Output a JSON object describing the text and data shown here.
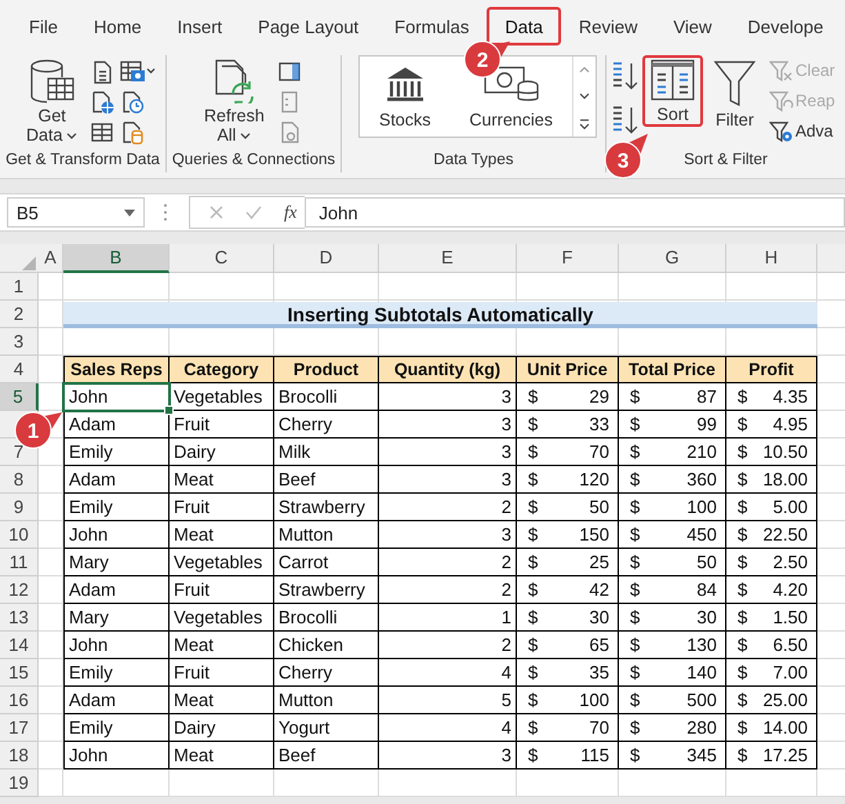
{
  "tabs": [
    {
      "label": "File",
      "selected": false,
      "highlighted": false
    },
    {
      "label": "Home",
      "selected": false,
      "highlighted": false
    },
    {
      "label": "Insert",
      "selected": false,
      "highlighted": false
    },
    {
      "label": "Page Layout",
      "selected": false,
      "highlighted": false
    },
    {
      "label": "Formulas",
      "selected": false,
      "highlighted": false
    },
    {
      "label": "Data",
      "selected": true,
      "highlighted": true
    },
    {
      "label": "Review",
      "selected": false,
      "highlighted": false
    },
    {
      "label": "View",
      "selected": false,
      "highlighted": false
    },
    {
      "label": "Develope",
      "selected": false,
      "highlighted": false
    }
  ],
  "ribbon": {
    "groups": [
      {
        "kind": "get",
        "label": "Get & Transform Data",
        "button": {
          "kind": "get-data",
          "label": "Get",
          "label2": "Data",
          "dropdown": true
        },
        "small_icons": [
          {
            "kind": "text-file",
            "disabled": false
          },
          {
            "kind": "web",
            "disabled": false
          },
          {
            "kind": "table",
            "disabled": false
          },
          {
            "kind": "camera",
            "disabled": false
          },
          {
            "kind": "recent",
            "disabled": false
          },
          {
            "kind": "existing",
            "disabled": false
          }
        ]
      },
      {
        "kind": "queries",
        "label": "Queries & Connections",
        "button": {
          "kind": "refresh",
          "label": "Refresh",
          "label2": "All",
          "dropdown": true
        },
        "small_icons": [
          {
            "kind": "panel",
            "disabled": false
          },
          {
            "kind": "properties",
            "disabled": true
          },
          {
            "kind": "links",
            "disabled": true
          }
        ]
      },
      {
        "kind": "types",
        "label": "Data Types",
        "gallery": [
          {
            "kind": "stocks",
            "label": "Stocks"
          },
          {
            "kind": "currencies",
            "label": "Currencies"
          }
        ]
      },
      {
        "kind": "sort",
        "label": "Sort & Filter",
        "sort_buttons": [
          {
            "kind": "az"
          },
          {
            "kind": "za"
          }
        ],
        "buttons": [
          {
            "kind": "sort",
            "label": "Sort",
            "highlighted": true
          },
          {
            "kind": "filter",
            "label": "Filter",
            "highlighted": false
          }
        ],
        "options": [
          {
            "kind": "clear",
            "label": "Clear",
            "disabled": true
          },
          {
            "kind": "reapply",
            "label": "Reap",
            "disabled": true
          },
          {
            "kind": "advanced",
            "label": "Adva",
            "disabled": false
          }
        ]
      }
    ]
  },
  "formula_bar": {
    "name_box": "B5",
    "function_label": "fx",
    "value": "John"
  },
  "sheet": {
    "columns": [
      {
        "label": "A",
        "selected": false
      },
      {
        "label": "B",
        "selected": true
      },
      {
        "label": "C",
        "selected": false
      },
      {
        "label": "D",
        "selected": false
      },
      {
        "label": "E",
        "selected": false
      },
      {
        "label": "F",
        "selected": false
      },
      {
        "label": "G",
        "selected": false
      },
      {
        "label": "H",
        "selected": false
      }
    ],
    "rows": [
      {
        "label": "1",
        "selected": false
      },
      {
        "label": "2",
        "selected": false
      },
      {
        "label": "3",
        "selected": false
      },
      {
        "label": "4",
        "selected": false
      },
      {
        "label": "5",
        "selected": true
      },
      {
        "selected": false
      },
      {
        "label": "7",
        "selected": false
      },
      {
        "label": "8",
        "selected": false
      },
      {
        "label": "9",
        "selected": false
      },
      {
        "label": "10",
        "selected": false
      },
      {
        "label": "11",
        "selected": false
      },
      {
        "label": "12",
        "selected": false
      },
      {
        "label": "13",
        "selected": false
      },
      {
        "label": "14",
        "selected": false
      },
      {
        "label": "15",
        "selected": false
      },
      {
        "label": "16",
        "selected": false
      },
      {
        "label": "17",
        "selected": false
      },
      {
        "label": "18",
        "selected": false
      },
      {
        "label": "19",
        "selected": false
      }
    ],
    "title": "Inserting Subtotals Automatically",
    "table": {
      "columns": [
        {
          "label": "Sales Reps",
          "kind": "text"
        },
        {
          "label": "Category",
          "kind": "text"
        },
        {
          "label": "Product",
          "kind": "text"
        },
        {
          "label": "Quantity (kg)",
          "kind": "number"
        },
        {
          "label": "Unit Price",
          "kind": "currency"
        },
        {
          "label": "Total Price",
          "kind": "currency"
        },
        {
          "label": "Profit",
          "kind": "currency"
        }
      ],
      "rows": [
        [
          "John",
          "Vegetables",
          "Brocolli",
          "3",
          [
            "$",
            "29"
          ],
          [
            "$",
            "87"
          ],
          [
            "$",
            "4.35"
          ]
        ],
        [
          "Adam",
          "Fruit",
          "Cherry",
          "3",
          [
            "$",
            "33"
          ],
          [
            "$",
            "99"
          ],
          [
            "$",
            "4.95"
          ]
        ],
        [
          "Emily",
          "Dairy",
          "Milk",
          "3",
          [
            "$",
            "70"
          ],
          [
            "$",
            "210"
          ],
          [
            "$",
            "10.50"
          ]
        ],
        [
          "Adam",
          "Meat",
          "Beef",
          "3",
          [
            "$",
            "120"
          ],
          [
            "$",
            "360"
          ],
          [
            "$",
            "18.00"
          ]
        ],
        [
          "Emily",
          "Fruit",
          "Strawberry",
          "2",
          [
            "$",
            "50"
          ],
          [
            "$",
            "100"
          ],
          [
            "$",
            "5.00"
          ]
        ],
        [
          "John",
          "Meat",
          "Mutton",
          "3",
          [
            "$",
            "150"
          ],
          [
            "$",
            "450"
          ],
          [
            "$",
            "22.50"
          ]
        ],
        [
          "Mary",
          "Vegetables",
          "Carrot",
          "2",
          [
            "$",
            "25"
          ],
          [
            "$",
            "50"
          ],
          [
            "$",
            "2.50"
          ]
        ],
        [
          "Adam",
          "Fruit",
          "Strawberry",
          "2",
          [
            "$",
            "42"
          ],
          [
            "$",
            "84"
          ],
          [
            "$",
            "4.20"
          ]
        ],
        [
          "Mary",
          "Vegetables",
          "Brocolli",
          "1",
          [
            "$",
            "30"
          ],
          [
            "$",
            "30"
          ],
          [
            "$",
            "1.50"
          ]
        ],
        [
          "John",
          "Meat",
          "Chicken",
          "2",
          [
            "$",
            "65"
          ],
          [
            "$",
            "130"
          ],
          [
            "$",
            "6.50"
          ]
        ],
        [
          "Emily",
          "Fruit",
          "Cherry",
          "4",
          [
            "$",
            "35"
          ],
          [
            "$",
            "140"
          ],
          [
            "$",
            "7.00"
          ]
        ],
        [
          "Adam",
          "Meat",
          "Mutton",
          "5",
          [
            "$",
            "100"
          ],
          [
            "$",
            "500"
          ],
          [
            "$",
            "25.00"
          ]
        ],
        [
          "Emily",
          "Dairy",
          "Yogurt",
          "4",
          [
            "$",
            "70"
          ],
          [
            "$",
            "280"
          ],
          [
            "$",
            "14.00"
          ]
        ],
        [
          "John",
          "Meat",
          "Beef",
          "3",
          [
            "$",
            "115"
          ],
          [
            "$",
            "345"
          ],
          [
            "$",
            "17.25"
          ]
        ]
      ]
    }
  },
  "callouts": [
    {
      "number": "1"
    },
    {
      "number": "2"
    },
    {
      "number": "3"
    }
  ]
}
